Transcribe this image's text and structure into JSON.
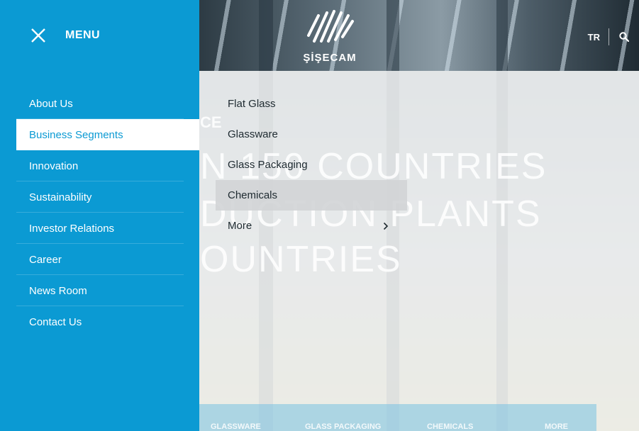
{
  "header": {
    "brand": "ŞİŞECAM",
    "language": "TR"
  },
  "menu": {
    "title": "MENU",
    "items": [
      {
        "label": "About Us"
      },
      {
        "label": "Business Segments"
      },
      {
        "label": "Innovation"
      },
      {
        "label": "Sustainability"
      },
      {
        "label": "Investor Relations"
      },
      {
        "label": "Career"
      },
      {
        "label": "News Room"
      },
      {
        "label": "Contact Us"
      }
    ],
    "active_index": 1
  },
  "submenu": {
    "items": [
      {
        "label": "Flat Glass"
      },
      {
        "label": "Glassware"
      },
      {
        "label": "Glass Packaging"
      },
      {
        "label": "Chemicals"
      },
      {
        "label": "More"
      }
    ],
    "hover_index": 3
  },
  "background": {
    "partial_word": "CE",
    "line1": "N 150 COUNTRIES",
    "line2": "DUCTION PLANTS",
    "line3": "OUNTRIES",
    "bottom_tabs": [
      {
        "label": "GLASSWARE"
      },
      {
        "label": "GLASS PACKAGING"
      },
      {
        "label": "CHEMICALS"
      },
      {
        "label": "MORE"
      }
    ]
  },
  "colors": {
    "menu_bg": "#0b9ad3",
    "active_text": "#0b9ad3"
  },
  "icons": {
    "close": "close-icon",
    "search": "search-icon",
    "more": "chevron-right-icon",
    "logo": "sisecam-logo-icon"
  }
}
